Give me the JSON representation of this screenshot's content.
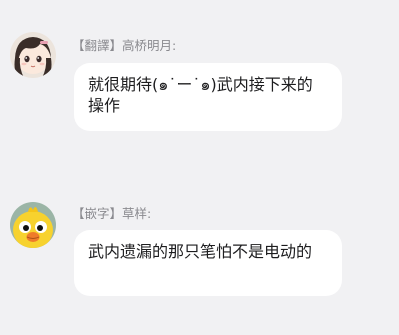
{
  "messages": [
    {
      "sender": "【翻譯】高桥明月:",
      "text": "就很期待(๑˙ー˙๑)武内接下来的操作",
      "avatar": "anime-girl-avatar"
    },
    {
      "sender": "【嵌字】草样:",
      "text": "武内遗漏的那只笔怕不是电动的",
      "avatar": "yellow-chick-avatar"
    }
  ],
  "colors": {
    "background": "#f1f1f3",
    "bubble": "#ffffff",
    "sender_text": "#8a8a8f",
    "message_text": "#1d1d1f"
  }
}
